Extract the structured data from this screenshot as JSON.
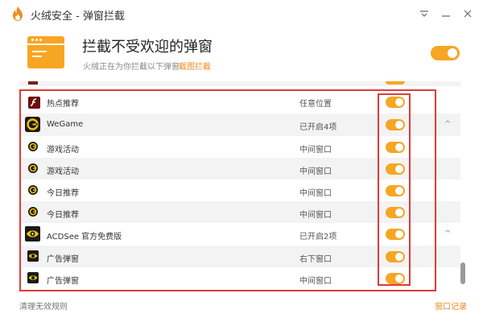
{
  "window": {
    "title": "火绒安全 - 弹窗拦截",
    "controls": [
      "menu-icon",
      "minimize-icon",
      "close-icon"
    ]
  },
  "header": {
    "title": "拦截不受欢迎的弹窗",
    "subtitle": "火绒正在为你拦截以下弹窗",
    "link": "截图拦截",
    "master_toggle": true
  },
  "rows": [
    {
      "icon": "flash-icon",
      "label": "热点推荐",
      "status": "任意位置",
      "enabled": true,
      "kind": "item"
    },
    {
      "icon": "wegame-icon",
      "label": "WeGame",
      "status": "已开启4项",
      "enabled": true,
      "kind": "group",
      "chevron": "^"
    },
    {
      "icon": "wegame-small-icon",
      "label": "游戏活动",
      "status": "中间窗口",
      "enabled": true,
      "kind": "child"
    },
    {
      "icon": "wegame-small-icon",
      "label": "游戏活动",
      "status": "中间窗口",
      "enabled": true,
      "kind": "child"
    },
    {
      "icon": "wegame-small-icon",
      "label": "今日推荐",
      "status": "中间窗口",
      "enabled": true,
      "kind": "child"
    },
    {
      "icon": "wegame-small-icon",
      "label": "今日推荐",
      "status": "中间窗口",
      "enabled": true,
      "kind": "child"
    },
    {
      "icon": "acdsee-icon",
      "label": "ACDSee 官方免费版",
      "status": "已开启2项",
      "enabled": true,
      "kind": "group",
      "chevron": "^"
    },
    {
      "icon": "acdsee-small-icon",
      "label": "广告弹窗",
      "status": "右下窗口",
      "enabled": true,
      "kind": "child"
    },
    {
      "icon": "acdsee-small-icon",
      "label": "广告弹窗",
      "status": "中间窗口",
      "enabled": true,
      "kind": "child"
    }
  ],
  "footer": {
    "left_link": "清理无效规则",
    "right_link": "窗口记录"
  },
  "colors": {
    "accent": "#f6a623",
    "link": "#f08a1c",
    "annotation": "#e03a3a"
  }
}
